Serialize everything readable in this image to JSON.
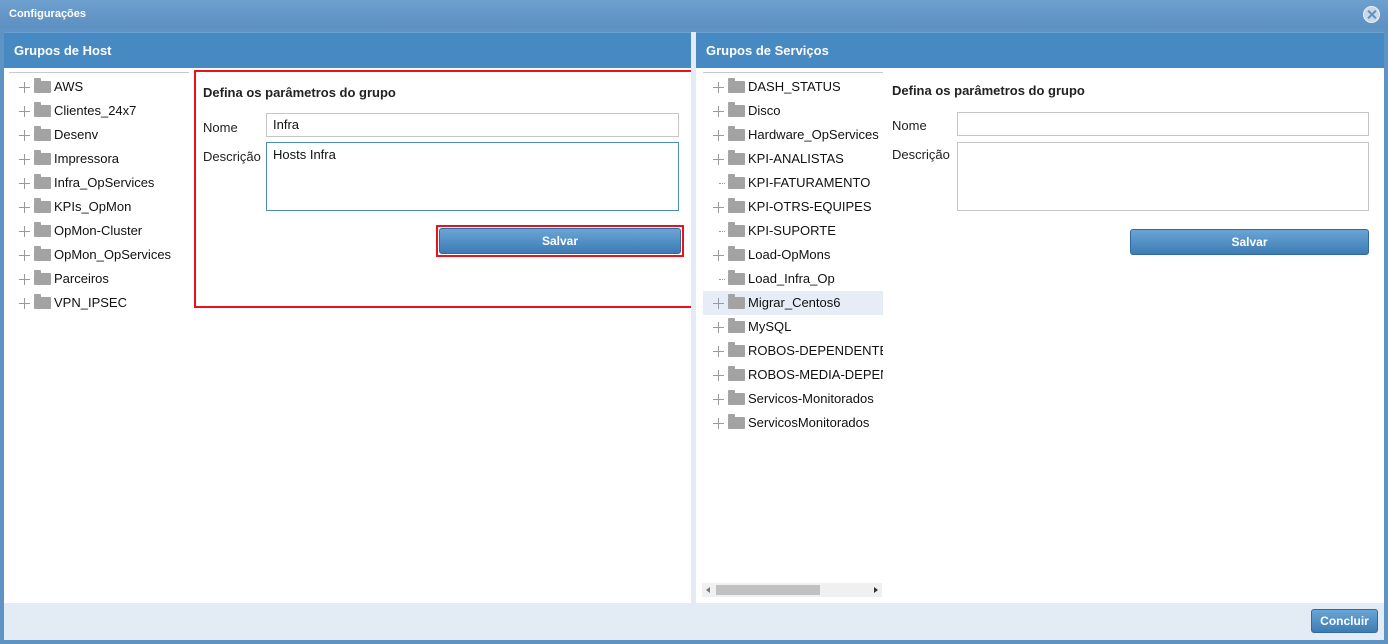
{
  "window": {
    "title": "Configurações"
  },
  "left_panel": {
    "title": "Grupos de Host",
    "tree": [
      {
        "label": "AWS",
        "expandable": true
      },
      {
        "label": "Clientes_24x7",
        "expandable": true
      },
      {
        "label": "Desenv",
        "expandable": true
      },
      {
        "label": "Impressora",
        "expandable": true
      },
      {
        "label": "Infra_OpServices",
        "expandable": true
      },
      {
        "label": "KPIs_OpMon",
        "expandable": true
      },
      {
        "label": "OpMon-Cluster",
        "expandable": true
      },
      {
        "label": "OpMon_OpServices",
        "expandable": true
      },
      {
        "label": "Parceiros",
        "expandable": true
      },
      {
        "label": "VPN_IPSEC",
        "expandable": true
      }
    ],
    "form": {
      "title": "Defina os parâmetros do grupo",
      "name_label": "Nome",
      "name_value": "Infra",
      "description_label": "Descrição",
      "description_value": "Hosts Infra",
      "save_label": "Salvar"
    }
  },
  "right_panel": {
    "title": "Grupos de Serviços",
    "tree": [
      {
        "label": "DASH_STATUS",
        "expandable": true
      },
      {
        "label": "Disco",
        "expandable": true
      },
      {
        "label": "Hardware_OpServices",
        "expandable": true
      },
      {
        "label": "KPI-ANALISTAS",
        "expandable": true
      },
      {
        "label": "KPI-FATURAMENTO",
        "expandable": false
      },
      {
        "label": "KPI-OTRS-EQUIPES",
        "expandable": true
      },
      {
        "label": "KPI-SUPORTE",
        "expandable": false
      },
      {
        "label": "Load-OpMons",
        "expandable": true
      },
      {
        "label": "Load_Infra_Op",
        "expandable": false
      },
      {
        "label": "Migrar_Centos6",
        "expandable": true,
        "selected": true
      },
      {
        "label": "MySQL",
        "expandable": true
      },
      {
        "label": "ROBOS-DEPENDENTES",
        "expandable": true
      },
      {
        "label": "ROBOS-MEDIA-DEPENDENTES",
        "expandable": true
      },
      {
        "label": "Servicos-Monitorados",
        "expandable": true
      },
      {
        "label": "ServicosMonitorados",
        "expandable": true
      }
    ],
    "form": {
      "title": "Defina os parâmetros do grupo",
      "name_label": "Nome",
      "name_value": "",
      "description_label": "Descrição",
      "description_value": "",
      "save_label": "Salvar"
    }
  },
  "footer": {
    "done_label": "Concluir"
  }
}
